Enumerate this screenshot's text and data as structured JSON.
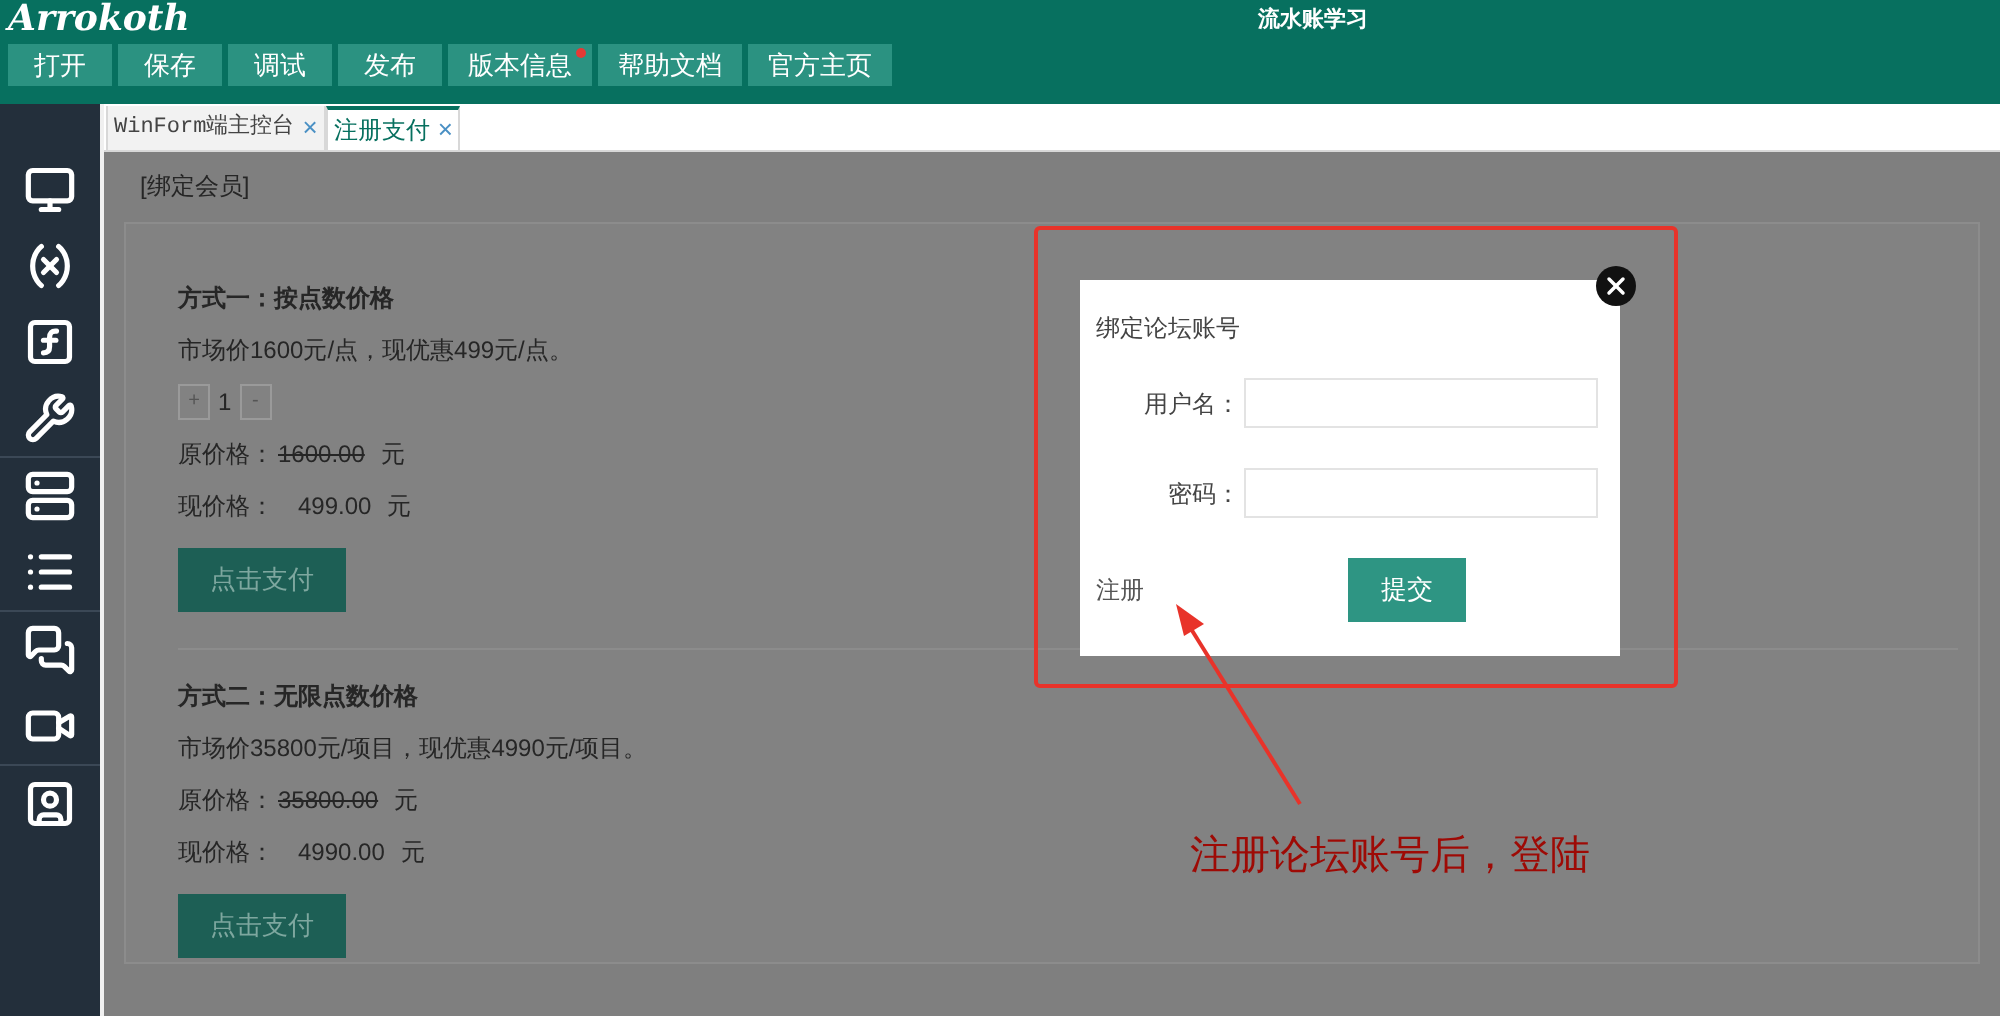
{
  "header": {
    "logo": "Arrokoth",
    "title": "流水账学习"
  },
  "toolbar": [
    {
      "label": "打开",
      "badge": false
    },
    {
      "label": "保存",
      "badge": false
    },
    {
      "label": "调试",
      "badge": false
    },
    {
      "label": "发布",
      "badge": false
    },
    {
      "label": "版本信息",
      "badge": true
    },
    {
      "label": "帮助文档",
      "badge": false
    },
    {
      "label": "官方主页",
      "badge": false
    }
  ],
  "tabs": [
    {
      "label": "WinForm端主控台",
      "close": "×",
      "selected": false
    },
    {
      "label": "注册支付",
      "close": "×",
      "selected": true
    }
  ],
  "section_label": "[绑定会员]",
  "plans": [
    {
      "heading": "方式一：按点数价格",
      "description": "市场价1600元/点，现优惠499元/点。",
      "stepper": {
        "plus": "+",
        "value": "1",
        "minus": "-"
      },
      "original_label": "原价格：",
      "original_price": "1600.00",
      "original_unit": "元",
      "current_label": "现价格：",
      "current_price": "499.00",
      "current_unit": "元",
      "button": "点击支付"
    },
    {
      "heading": "方式二：无限点数价格",
      "description": "市场价35800元/项目，现优惠4990元/项目。",
      "original_label": "原价格：",
      "original_price": "35800.00",
      "original_unit": "元",
      "current_label": "现价格：",
      "current_price": "4990.00",
      "current_unit": "元",
      "button": "点击支付"
    }
  ],
  "dialog": {
    "title": "绑定论坛账号",
    "fields": [
      {
        "label": "用户名："
      },
      {
        "label": "密码："
      }
    ],
    "register_link": "注册",
    "submit": "提交"
  },
  "annotation": {
    "text": "注册论坛账号后，登陆"
  }
}
